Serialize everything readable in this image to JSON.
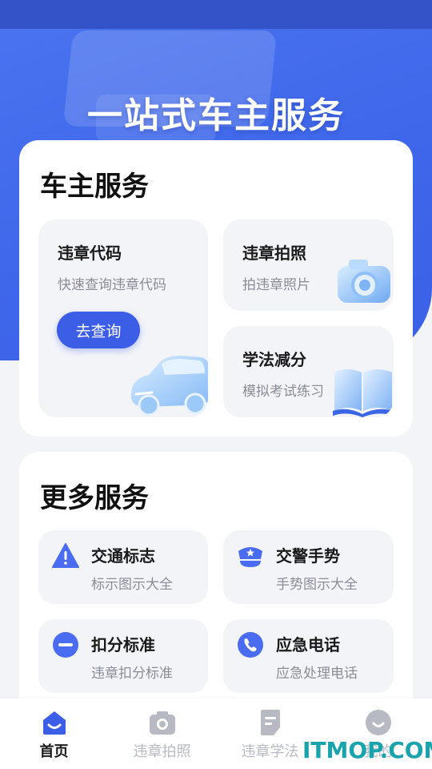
{
  "hero": {
    "title": "一站式车主服务"
  },
  "owner_services": {
    "title": "车主服务",
    "violation_code": {
      "title": "违章代码",
      "subtitle": "快速查询违章代码",
      "button": "去查询",
      "illustration": "car-icon"
    },
    "violation_photo": {
      "title": "违章拍照",
      "subtitle": "拍违章照片",
      "illustration": "camera-icon"
    },
    "study": {
      "title": "学法减分",
      "subtitle": "模拟考试练习",
      "illustration": "book-icon"
    }
  },
  "more_services": {
    "title": "更多服务",
    "items": [
      {
        "title": "交通标志",
        "subtitle": "标示图示大全",
        "icon": "warning-triangle-icon"
      },
      {
        "title": "交警手势",
        "subtitle": "手势图示大全",
        "icon": "police-cap-icon"
      },
      {
        "title": "扣分标准",
        "subtitle": "违章扣分标准",
        "icon": "minus-circle-icon"
      },
      {
        "title": "应急电话",
        "subtitle": "应急处理电话",
        "icon": "phone-icon"
      }
    ]
  },
  "tabbar": {
    "tabs": [
      {
        "label": "首页",
        "icon": "home-icon",
        "active": true
      },
      {
        "label": "违章拍照",
        "icon": "camera-icon",
        "active": false
      },
      {
        "label": "违章学法",
        "icon": "document-icon",
        "active": false
      },
      {
        "label": "我的",
        "icon": "profile-icon",
        "active": false
      }
    ]
  },
  "watermark": "ITMOP.COM",
  "colors": {
    "primary": "#3c5ee6",
    "hero_bg": "#4169ec",
    "tile_bg": "#f3f4f8",
    "text_secondary": "#8a8d96",
    "tab_inactive": "#b7bac2",
    "watermark": "#19a3ad"
  }
}
